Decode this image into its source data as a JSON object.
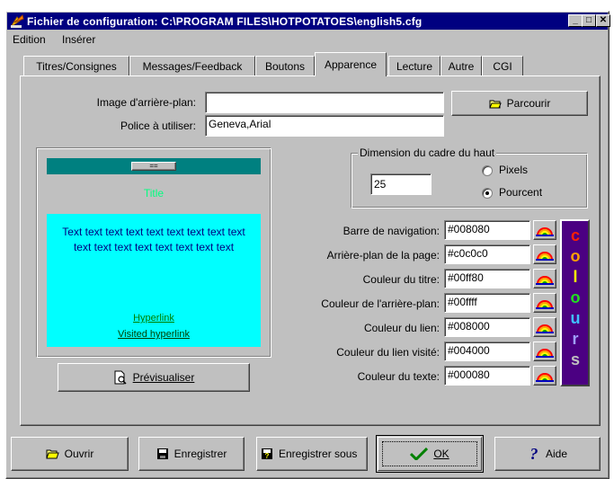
{
  "window": {
    "title": "Fichier de configuration: C:\\PROGRAM FILES\\HOTPOTATOES\\english5.cfg",
    "minimize": "_",
    "maximize": "□",
    "close": "✕"
  },
  "menu": {
    "items": [
      "Edition",
      "Insérer"
    ]
  },
  "tabs": [
    {
      "label": "Titres/Consignes",
      "active": false
    },
    {
      "label": "Messages/Feedback",
      "active": false
    },
    {
      "label": "Boutons",
      "active": false
    },
    {
      "label": "Apparence",
      "active": true
    },
    {
      "label": "Lecture",
      "active": false
    },
    {
      "label": "Autre",
      "active": false
    },
    {
      "label": "CGI",
      "active": false
    }
  ],
  "background_image": {
    "label": "Image d'arrière-plan:",
    "value": ""
  },
  "browse_button": {
    "label": "Parcourir",
    "icon": "open-folder-icon"
  },
  "font": {
    "label": "Police à utiliser:",
    "value": "Geneva,Arial"
  },
  "frame": {
    "legend": "Dimension du cadre du haut",
    "size_value": "25",
    "pixels_label": "Pixels",
    "percent_label": "Pourcent",
    "selected": "percent"
  },
  "preview": {
    "nav_label": "==",
    "title": "Title",
    "body_text": "Text text text text text text text text text text text text text text text text text",
    "hyperlink": "Hyperlink",
    "visited_hyperlink": "Visited hyperlink"
  },
  "preview_button": {
    "label": "Prévisualiser",
    "icon": "preview-document-icon"
  },
  "colors": [
    {
      "label": "Barre de navigation:",
      "value": "#008080"
    },
    {
      "label": "Arrière-plan de la page:",
      "value": "#c0c0c0"
    },
    {
      "label": "Couleur du titre:",
      "value": "#00ff80"
    },
    {
      "label": "Couleur de l'arrière-plan:",
      "value": "#00ffff"
    },
    {
      "label": "Couleur du lien:",
      "value": "#008000"
    },
    {
      "label": "Couleur du lien visité:",
      "value": "#004000"
    },
    {
      "label": "Couleur du texte:",
      "value": "#000080"
    }
  ],
  "colours_logo": "colours",
  "bottom_buttons": {
    "open": "Ouvrir",
    "save": "Enregistrer",
    "save_as": "Enregistrer sous",
    "ok": "OK",
    "help": "Aide"
  },
  "theme": {
    "titlebar": "#000080",
    "face": "#c0c0c0",
    "preview_nav": "#008080",
    "preview_title": "#00ff80",
    "preview_bg": "#00ffff",
    "preview_text": "#000080",
    "preview_link": "#008000",
    "preview_visited": "#004000"
  }
}
